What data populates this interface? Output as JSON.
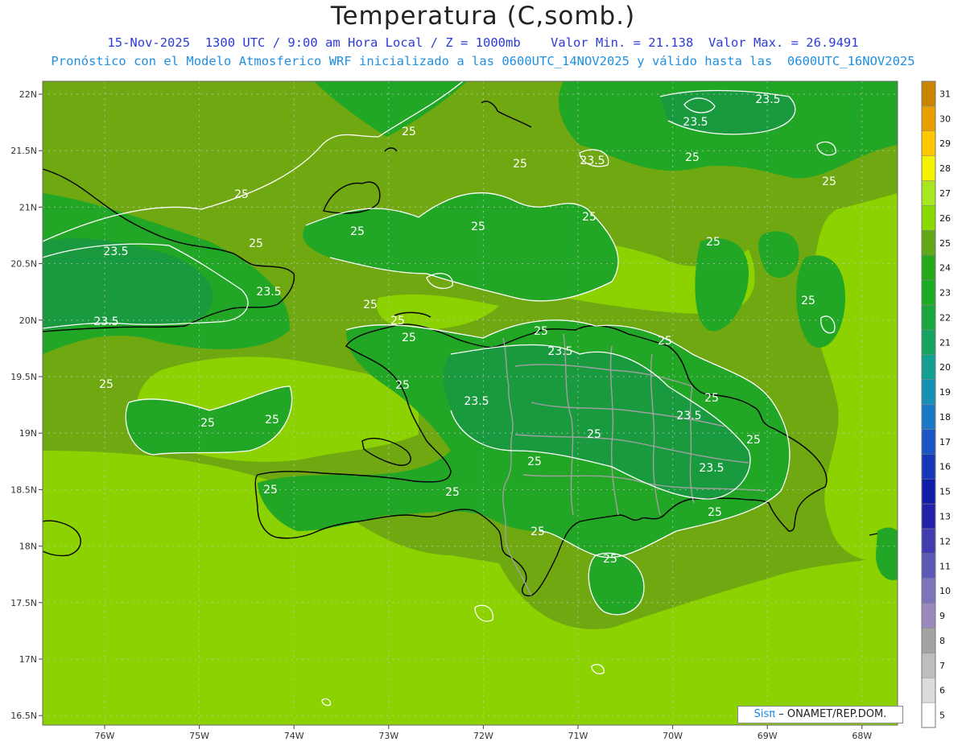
{
  "header": {
    "title": "Temperatura (C,somb.)",
    "line1": "15-Nov-2025  1300 UTC / 9:00 am Hora Local / Z = 1000mb    Valor Min. = 21.138  Valor Max. = 26.9491",
    "line2": "Pronóstico con el Modelo Atmosferico WRF inicializado a las 0600UTC_14NOV2025 y válido hasta las  0600UTC_16NOV2025"
  },
  "axes": {
    "lat_labels": [
      "22N",
      "21.5N",
      "21N",
      "20.5N",
      "20N",
      "19.5N",
      "19N",
      "18.5N",
      "18N",
      "17.5N",
      "17N",
      "16.5N"
    ],
    "lon_labels": [
      "76W",
      "75W",
      "74W",
      "73W",
      "72W",
      "71W",
      "70W",
      "69W",
      "68W"
    ]
  },
  "colorbar": {
    "labels": [
      "5",
      "6",
      "7",
      "8",
      "9",
      "10",
      "11",
      "12",
      "13",
      "15",
      "16",
      "17",
      "18",
      "19",
      "20",
      "21",
      "22",
      "23",
      "24",
      "25",
      "26",
      "27",
      "28",
      "29",
      "30",
      "31"
    ],
    "colors": [
      "#ffffff",
      "#dcdcdc",
      "#bdbdbd",
      "#a3a3a3",
      "#9a88bf",
      "#7c74bd",
      "#5c58b7",
      "#3e3cb0",
      "#2222a8",
      "#0f1ea8",
      "#1537b8",
      "#1a56c4",
      "#1a78c4",
      "#1690b4",
      "#14a090",
      "#17a460",
      "#18a83c",
      "#1aac24",
      "#28a81c",
      "#60a818",
      "#8ad800",
      "#a8e620",
      "#f4f400",
      "#ffc800",
      "#e8a000",
      "#c88600"
    ]
  },
  "contour_labels": [
    "25",
    "23.5"
  ],
  "map_colors": {
    "base": "#6fa810",
    "light": "#8cd200",
    "green": "#22a626",
    "dark": "#1a9a3e",
    "coast": "#000000",
    "provinces": "#a0a0a0",
    "contour": "#ffffff"
  },
  "credit": {
    "sis": "Sisπ",
    "rest": "– ONAMET/REP.DOM."
  }
}
